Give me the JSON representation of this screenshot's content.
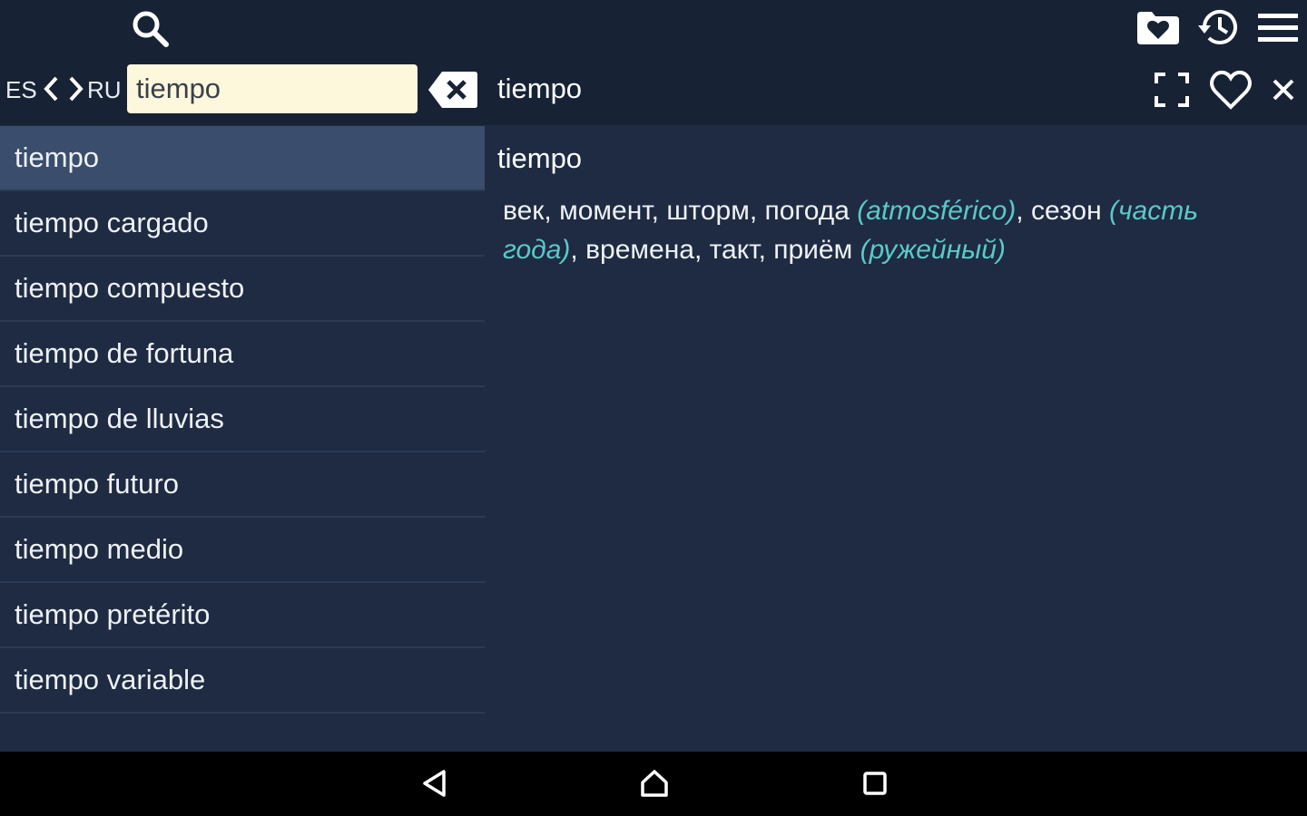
{
  "toolbar": {
    "icons": [
      "search-icon",
      "favorites-folder-icon",
      "history-icon",
      "menu-icon"
    ]
  },
  "language": {
    "source": "ES",
    "target": "RU"
  },
  "search": {
    "value": "tiempo"
  },
  "header": {
    "word": "tiempo",
    "icons": [
      "fullscreen-icon",
      "heart-icon",
      "close-icon"
    ]
  },
  "word_list": {
    "selected_index": 0,
    "items": [
      "tiempo",
      "tiempo cargado",
      "tiempo compuesto",
      "tiempo de fortuna",
      "tiempo de lluvias",
      "tiempo futuro",
      "tiempo medio",
      "tiempo pretérito",
      "tiempo variable"
    ]
  },
  "entry": {
    "headword": "tiempo",
    "segments": [
      {
        "text": "век, момент, шторм, погода ",
        "note": false
      },
      {
        "text": "(atmosférico)",
        "note": true
      },
      {
        "text": ", сезон ",
        "note": false
      },
      {
        "text": "(часть года)",
        "note": true
      },
      {
        "text": ", времена, такт, приём ",
        "note": false
      },
      {
        "text": "(ружейный)",
        "note": true
      }
    ]
  },
  "navbar": {
    "icons": [
      "back-icon",
      "home-icon",
      "recents-icon"
    ]
  },
  "colors": {
    "topbar": "#172235",
    "background": "#1e2b42",
    "selected_row": "#3a4d6c",
    "divider": "#2b3a55",
    "search_field": "#fdf7dc",
    "note": "#5cc8c8",
    "navbar": "#000000"
  }
}
